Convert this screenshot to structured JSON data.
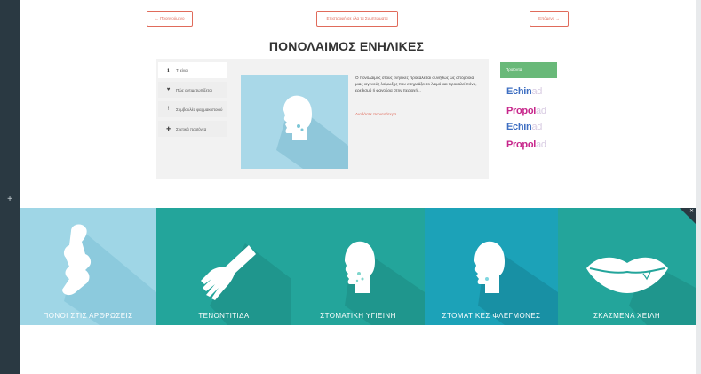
{
  "nav": {
    "prev_label": "← Προηγούμενο",
    "all_label": "Επιστροφή σε όλα τα Συμπτώματα",
    "next_label": "Επόμενο →"
  },
  "page": {
    "title": "ΠΟΝΟΛΑΙΜΟΣ ΕΝΗΛΙΚΕΣ"
  },
  "menu": {
    "items": [
      {
        "label": "Τι είναι",
        "icon": "info-icon"
      },
      {
        "label": "Πώς αντιμετωπίζεται",
        "icon": "heart-icon"
      },
      {
        "label": "Συμβουλές φαρμακοποιού",
        "icon": "tip-icon"
      },
      {
        "label": "Σχετικά προϊόντα",
        "icon": "product-icon"
      }
    ]
  },
  "article": {
    "description": "Ο πονόλαιμος στους ενήλικες προκαλείται συνήθως ως απόρροια μιας ιογενούς λοίμωξης που επηρεάζει το λαιμό και προκαλεί πόνο, ερεθισμό ή φαγούρα στην περιοχή...",
    "read_more": "Διαβάστε περισσότερα"
  },
  "products": {
    "header": "Προϊόντα",
    "brands": [
      {
        "a": "Echin",
        "b": "ad",
        "sub": "",
        "color": "#3f6fc2"
      },
      {
        "a": "Propol",
        "b": "ad",
        "sub": "",
        "color": "#c7268b"
      },
      {
        "a": "Echin",
        "b": "ad",
        "sub": "",
        "color": "#3f6fc2"
      },
      {
        "a": "Propol",
        "b": "ad",
        "sub": "",
        "color": "#c7268b"
      }
    ]
  },
  "tiles": [
    {
      "label": "ΠΟΝΟΙ ΣΤΙΣ ΑΡΘΡΩΣΕΙΣ",
      "icon": "joint-icon",
      "color": "#9fd6e6"
    },
    {
      "label": "ΤΕΝΟΝΤΙΤΙΔΑ",
      "icon": "hand-icon",
      "color": "#23a59b"
    },
    {
      "label": "ΣΤΟΜΑΤΙΚΗ ΥΓΙΕΙΝΗ",
      "icon": "head-icon",
      "color": "#23a59b"
    },
    {
      "label": "ΣΤΟΜΑΤΙΚΕΣ ΦΛΕΓΜΟΝΕΣ",
      "icon": "head-icon",
      "color": "#1ca2b8"
    },
    {
      "label": "ΣΚΑΣΜΕΝΑ ΧΕΙΛΗ",
      "icon": "lips-icon",
      "color": "#23a59b"
    }
  ],
  "colors": {
    "accent": "#e06b5b",
    "sidebar": "#2a3942",
    "product_header": "#69b979"
  }
}
